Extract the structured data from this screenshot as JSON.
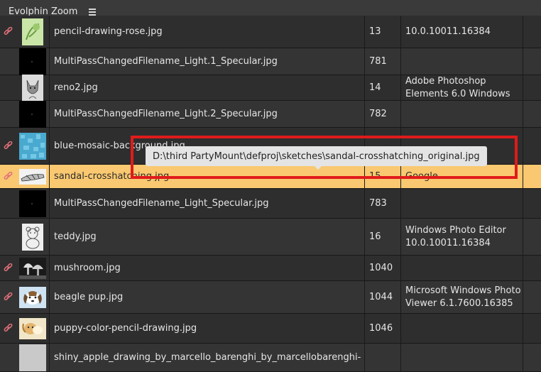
{
  "app": {
    "title": "Evolphin Zoom"
  },
  "colors": {
    "selected_row": "#f9c870",
    "highlight_box": "#e01b1b",
    "link_icon": "#e0707a"
  },
  "rows": [
    {
      "name": "pencil-drawing-rose.jpg",
      "size": "13",
      "app": "10.0.10011.16384",
      "linked": true,
      "thumb": "rose-sketch"
    },
    {
      "name": "MultiPassChangedFilename_Light.1_Specular.jpg",
      "size": "781",
      "app": "",
      "linked": false,
      "thumb": "black"
    },
    {
      "name": "reno2.jpg",
      "size": "14",
      "app": "Adobe Photoshop Elements 6.0 Windows",
      "linked": false,
      "thumb": "cat-sketch"
    },
    {
      "name": "MultiPassChangedFilename_Light.2_Specular.jpg",
      "size": "782",
      "app": "",
      "linked": false,
      "thumb": "black"
    },
    {
      "name": "blue-mosaic-background.jpg",
      "size": "",
      "app": "",
      "linked": true,
      "thumb": "blue-mosaic"
    },
    {
      "name": "sandal-crosshatching.jpg",
      "size": "15",
      "app": "Google",
      "linked": true,
      "thumb": "sandal",
      "selected": true
    },
    {
      "name": "MultiPassChangedFilename_Light_Specular.jpg",
      "size": "783",
      "app": "",
      "linked": false,
      "thumb": "black"
    },
    {
      "name": "teddy.jpg",
      "size": "16",
      "app": "Windows Photo Editor 10.0.10011.16384",
      "linked": false,
      "thumb": "teddy"
    },
    {
      "name": "mushroom.jpg",
      "size": "1040",
      "app": "",
      "linked": true,
      "thumb": "mushroom"
    },
    {
      "name": "beagle pup.jpg",
      "size": "1044",
      "app": "Microsoft Windows Photo Viewer 6.1.7600.16385",
      "linked": true,
      "thumb": "beagle"
    },
    {
      "name": "puppy-color-pencil-drawing.jpg",
      "size": "1046",
      "app": "",
      "linked": true,
      "thumb": "puppy"
    },
    {
      "name": "shiny_apple_drawing_by_marcello_barenghi_by_marcellobarenghi-",
      "size": "",
      "app": "",
      "linked": false,
      "thumb": "apple"
    }
  ],
  "tooltip": {
    "text": "D:\\third PartyMount\\defproj\\sketches\\sandal-crosshatching_original.jpg"
  }
}
